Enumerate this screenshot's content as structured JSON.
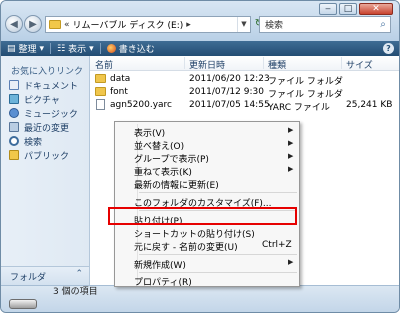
{
  "window": {
    "address_path": "リムーバブル ディスク (E:)",
    "address_prefix": "«",
    "search_placeholder": "検索"
  },
  "toolbar": {
    "organize": "整理",
    "views": "表示",
    "burn": "書き込む"
  },
  "sidebar": {
    "favorites_title": "お気に入りリンク",
    "items": [
      {
        "label": "ドキュメント",
        "icon": "documents-icon"
      },
      {
        "label": "ピクチャ",
        "icon": "pictures-icon"
      },
      {
        "label": "ミュージック",
        "icon": "music-icon"
      },
      {
        "label": "最近の変更",
        "icon": "recent-icon"
      },
      {
        "label": "検索",
        "icon": "search-icon"
      },
      {
        "label": "パブリック",
        "icon": "public-icon"
      }
    ],
    "folders_label": "フォルダ"
  },
  "columns": {
    "name": "名前",
    "date": "更新日時",
    "type": "種類",
    "size": "サイズ"
  },
  "files": [
    {
      "name": "data",
      "date": "2011/06/20 12:23",
      "type": "ファイル フォルダ",
      "size": ""
    },
    {
      "name": "font",
      "date": "2011/07/12 9:30",
      "type": "ファイル フォルダ",
      "size": ""
    },
    {
      "name": "agn5200.yarc",
      "date": "2011/07/05 14:55",
      "type": "YARC ファイル",
      "size": "25,241 KB"
    }
  ],
  "status": {
    "item_count": "3 個の項目"
  },
  "context_menu": {
    "view": "表示(V)",
    "sort": "並べ替え(O)",
    "group": "グループで表示(P)",
    "stack": "重ねて表示(K)",
    "refresh": "最新の情報に更新(E)",
    "customize": "このフォルダのカスタマイズ(F)...",
    "paste": "貼り付け(P)",
    "paste_shortcut": "ショートカットの貼り付け(S)",
    "undo": "元に戻す - 名前の変更(U)",
    "undo_shortcut": "Ctrl+Z",
    "new": "新規作成(W)",
    "properties": "プロパティ(R)"
  },
  "highlight_color": "#e60000"
}
